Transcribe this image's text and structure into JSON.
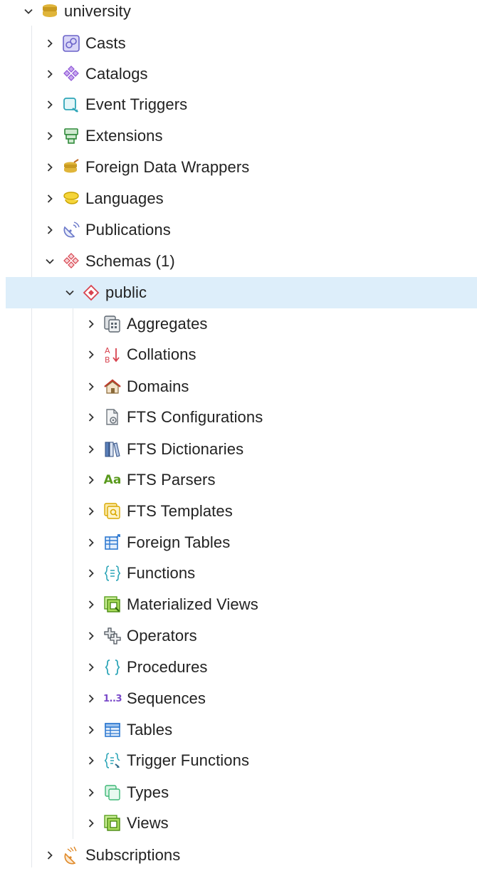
{
  "colors": {
    "selected_bg": "#ddeefa",
    "text": "#222222",
    "guide": "#e3e7eb"
  },
  "tree": {
    "root": {
      "label": "university",
      "icon": "database-icon",
      "expanded": true
    },
    "level1": [
      {
        "label": "Casts",
        "icon": "casts-icon",
        "expanded": false
      },
      {
        "label": "Catalogs",
        "icon": "catalogs-icon",
        "expanded": false
      },
      {
        "label": "Event Triggers",
        "icon": "event-triggers-icon",
        "expanded": false
      },
      {
        "label": "Extensions",
        "icon": "extensions-icon",
        "expanded": false
      },
      {
        "label": "Foreign Data Wrappers",
        "icon": "foreign-data-wrappers-icon",
        "expanded": false
      },
      {
        "label": "Languages",
        "icon": "languages-icon",
        "expanded": false
      },
      {
        "label": "Publications",
        "icon": "publications-icon",
        "expanded": false
      },
      {
        "label": "Schemas (1)",
        "icon": "schemas-icon",
        "expanded": true
      }
    ],
    "schema": {
      "label": "public",
      "icon": "schema-icon",
      "expanded": true,
      "selected": true
    },
    "schema_children": [
      {
        "label": "Aggregates",
        "icon": "aggregates-icon"
      },
      {
        "label": "Collations",
        "icon": "collations-icon"
      },
      {
        "label": "Domains",
        "icon": "domains-icon"
      },
      {
        "label": "FTS Configurations",
        "icon": "fts-configurations-icon"
      },
      {
        "label": "FTS Dictionaries",
        "icon": "fts-dictionaries-icon"
      },
      {
        "label": "FTS Parsers",
        "icon": "fts-parsers-icon",
        "icon_text": "Aa"
      },
      {
        "label": "FTS Templates",
        "icon": "fts-templates-icon"
      },
      {
        "label": "Foreign Tables",
        "icon": "foreign-tables-icon"
      },
      {
        "label": "Functions",
        "icon": "functions-icon"
      },
      {
        "label": "Materialized Views",
        "icon": "materialized-views-icon"
      },
      {
        "label": "Operators",
        "icon": "operators-icon"
      },
      {
        "label": "Procedures",
        "icon": "procedures-icon"
      },
      {
        "label": "Sequences",
        "icon": "sequences-icon",
        "icon_text": "1..3"
      },
      {
        "label": "Tables",
        "icon": "tables-icon"
      },
      {
        "label": "Trigger Functions",
        "icon": "trigger-functions-icon"
      },
      {
        "label": "Types",
        "icon": "types-icon"
      },
      {
        "label": "Views",
        "icon": "views-icon"
      }
    ],
    "after": [
      {
        "label": "Subscriptions",
        "icon": "subscriptions-icon",
        "expanded": false
      }
    ]
  }
}
